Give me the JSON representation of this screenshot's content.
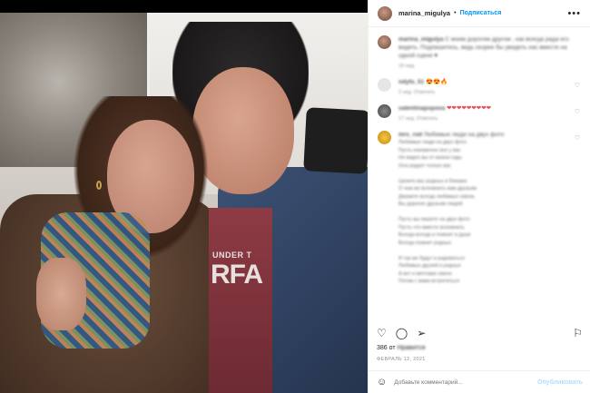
{
  "post": {
    "username": "marina_migulya",
    "separator": "•",
    "follow_label": "Подписаться",
    "more_label": "•••",
    "photo": {
      "shirt_line": "UNDER T",
      "shirt_big": "RFA"
    }
  },
  "comments": [
    {
      "user": "marina_migulya",
      "text": "С моим дорогим другом , как всегда рада его видеть. Подпишитесь, ведь скорее бы увидеть нас вместе на одной сцене ♥",
      "meta": "19 нед."
    },
    {
      "user": "ndyfa_51",
      "text": "😍😍🔥",
      "meta": "2 нед.  Ответить",
      "hearts": true
    },
    {
      "user": "valentinapopova",
      "text": "❤❤❤❤❤❤❤❤❤",
      "meta": "17 нед.  Ответить",
      "hearts": true
    },
    {
      "user": "mrs_rod",
      "text": "Любимые люди на двух фото",
      "meta": "",
      "poem": [
        "Любимые люди на двух фото",
        "Пусть неизменно все у вас",
        "Не видно вы от жизни годы",
        "Она радует только вас",
        "",
        "Цените вас родных и близких",
        "О чем же вспомнить вам друзьям",
        "Держите всегда любимых сквозь",
        "Вы дорогие друзьям людей",
        "",
        "Пусть вы пишете на двух фото",
        "Пусть что вместе вспомнить",
        "Всегда всегда и помнит в душе",
        "Всегда помнит родных",
        "",
        "И так же будут и радоваться",
        "Любимых друзей и родных",
        "А вот и мечтами смело",
        "Потом с вами встретиться"
      ]
    }
  ],
  "actions": {
    "like_icon": "heart-icon",
    "comment_icon": "comment-icon",
    "share_icon": "share-icon",
    "save_icon": "bookmark-icon"
  },
  "likes": {
    "count": "386",
    "label_visible": "от",
    "label_blurred": "Нравится"
  },
  "date": "ФЕВРАЛЬ 12, 2021",
  "comment_box": {
    "placeholder": "Добавьте комментарий...",
    "post_label": "Опубликовать"
  }
}
